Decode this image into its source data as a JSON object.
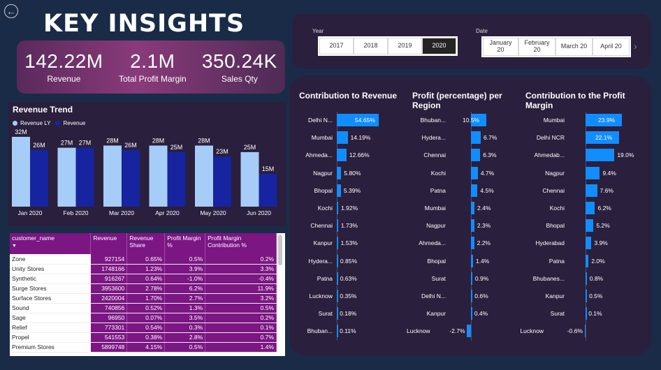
{
  "page": {
    "title": "KEY INSIGHTS"
  },
  "kpis": [
    {
      "value": "142.22M",
      "label": "Revenue"
    },
    {
      "value": "2.1M",
      "label": "Total Profit Margin"
    },
    {
      "value": "350.24K",
      "label": "Sales Qty"
    }
  ],
  "filters": {
    "year_label": "Year",
    "years": [
      "2017",
      "2018",
      "2019",
      "2020"
    ],
    "year_selected": "2020",
    "date_label": "Date",
    "dates": [
      [
        "January",
        "20"
      ],
      [
        "February",
        "20"
      ],
      [
        "March 20"
      ],
      [
        "April 20"
      ]
    ]
  },
  "colors": {
    "revenue_ly": "#a6cdf7",
    "revenue": "#1724a0",
    "bar": "#118dff",
    "table_header": "#7b1683"
  },
  "revenue_trend": {
    "title": "Revenue Trend",
    "legend": [
      "Revenue LY",
      "Revenue"
    ]
  },
  "table": {
    "columns": [
      "customer_name",
      "Revenue",
      "Revenue Share",
      "Profit Margin %",
      "Profit Margin Contribution %"
    ],
    "rows": [
      [
        "Zone",
        "927154",
        "0.65%",
        "0.5%",
        "0.2%"
      ],
      [
        "Unity Stores",
        "1748166",
        "1.23%",
        "3.9%",
        "3.3%"
      ],
      [
        "Synthetic",
        "916267",
        "0.64%",
        "-1.0%",
        "-0.4%"
      ],
      [
        "Surge Stores",
        "3953600",
        "2.78%",
        "6.2%",
        "11.9%"
      ],
      [
        "Surface Stores",
        "2420004",
        "1.70%",
        "2.7%",
        "3.2%"
      ],
      [
        "Sound",
        "740856",
        "0.52%",
        "1.3%",
        "0.5%"
      ],
      [
        "Sage",
        "96950",
        "0.07%",
        "3.5%",
        "0.2%"
      ],
      [
        "Relief",
        "773301",
        "0.54%",
        "0.3%",
        "0.1%"
      ],
      [
        "Propel",
        "541553",
        "0.38%",
        "2.8%",
        "0.7%"
      ],
      [
        "Premium Stores",
        "5899748",
        "4.15%",
        "0.5%",
        "1.4%"
      ]
    ]
  },
  "chart_data": [
    {
      "type": "bar",
      "title": "Revenue Trend",
      "categories": [
        "Jan 2020",
        "Feb 2020",
        "Mar 2020",
        "Apr 2020",
        "May 2020",
        "Jun 2020"
      ],
      "series": [
        {
          "name": "Revenue LY",
          "values": [
            32,
            27,
            28,
            28,
            28,
            25
          ],
          "labels": [
            "32M",
            "27M",
            "28M",
            "28M",
            "28M",
            "25M"
          ]
        },
        {
          "name": "Revenue",
          "values": [
            26,
            27,
            26,
            25,
            23,
            15
          ],
          "labels": [
            "26M",
            "27M",
            "26M",
            "25M",
            "23M",
            "15M"
          ]
        }
      ],
      "ylim": [
        0,
        32
      ]
    },
    {
      "type": "bar",
      "title": "Contribution to Revenue",
      "categories": [
        "Delhi N...",
        "Mumbai",
        "Ahmeda...",
        "Nagpur",
        "Bhopal",
        "Kochi",
        "Chennai",
        "Kanpur",
        "Hydera...",
        "Patna",
        "Lucknow",
        "Surat",
        "Bhuban..."
      ],
      "values": [
        54.65,
        14.19,
        12.66,
        5.8,
        5.39,
        1.92,
        1.73,
        1.53,
        0.85,
        0.63,
        0.35,
        0.18,
        0.11
      ],
      "labels": [
        "54.65%",
        "14.19%",
        "12.66%",
        "5.80%",
        "5.39%",
        "1.92%",
        "1.73%",
        "1.53%",
        "0.85%",
        "0.63%",
        "0.35%",
        "0.18%",
        "0.11%"
      ]
    },
    {
      "type": "bar",
      "title": "Profit (percentage) per Region",
      "categories": [
        "Bhuban...",
        "Hydera...",
        "Chennai",
        "Kochi",
        "Patna",
        "Mumbai",
        "Nagpur",
        "Ahmeda...",
        "Bhopal",
        "Surat",
        "Delhi N...",
        "Kanpur",
        "Lucknow"
      ],
      "values": [
        10.5,
        6.7,
        6.3,
        4.7,
        4.5,
        2.4,
        2.3,
        2.2,
        1.4,
        0.9,
        0.6,
        0.4,
        -2.7
      ],
      "labels": [
        "10.5%",
        "6.7%",
        "6.3%",
        "4.7%",
        "4.5%",
        "2.4%",
        "2.3%",
        "2.2%",
        "1.4%",
        "0.9%",
        "0.6%",
        "0.4%",
        "-2.7%"
      ]
    },
    {
      "type": "bar",
      "title": "Contribution to the Profit Margin",
      "categories": [
        "Mumbai",
        "Delhi NCR",
        "Ahmedab...",
        "Nagpur",
        "Chennai",
        "Kochi",
        "Bhopal",
        "Hyderabad",
        "Patna",
        "Bhubanes...",
        "Kanpur",
        "Surat",
        "Lucknow"
      ],
      "values": [
        23.9,
        22.1,
        19.0,
        9.4,
        7.6,
        6.2,
        5.2,
        3.9,
        2.0,
        0.8,
        0.5,
        0.1,
        -0.6
      ],
      "labels": [
        "23.9%",
        "22.1%",
        "19.0%",
        "9.4%",
        "7.6%",
        "6.2%",
        "5.2%",
        "3.9%",
        "2.0%",
        "0.8%",
        "0.5%",
        "0.1%",
        "-0.6%"
      ]
    }
  ]
}
